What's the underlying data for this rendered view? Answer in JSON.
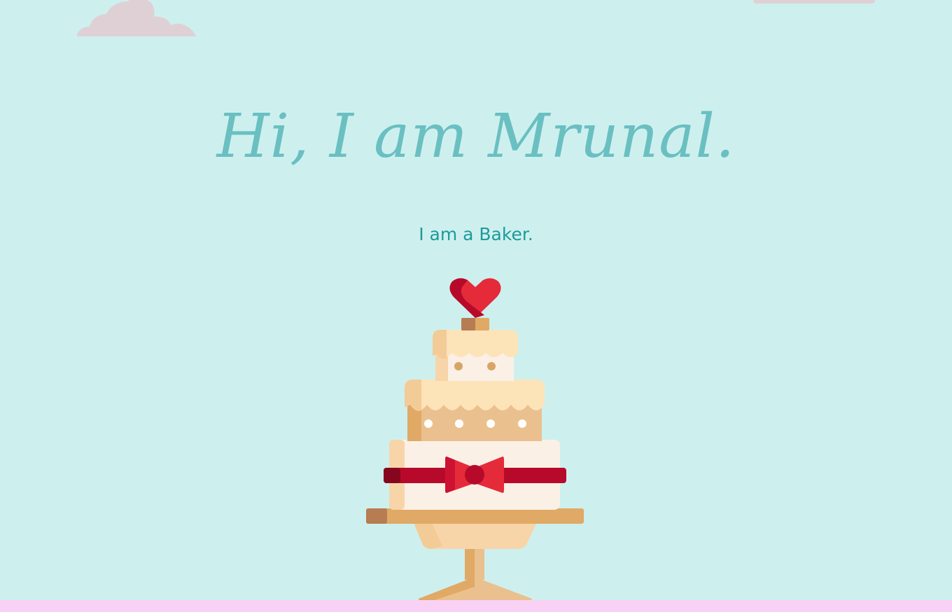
{
  "hero": {
    "title": "Hi, I am Mrunal.",
    "subtitle": "I am a Baker."
  },
  "illustration": {
    "icon": "wedding-cake-icon"
  },
  "colors": {
    "background": "#cdf0ef",
    "title": "#6abfc1",
    "subtitle": "#1e9a9a",
    "cloud": "#dfd0d6",
    "ground": "#f9d1f4",
    "ribbon": "#b70a2a",
    "heart": "#e52a3a"
  }
}
